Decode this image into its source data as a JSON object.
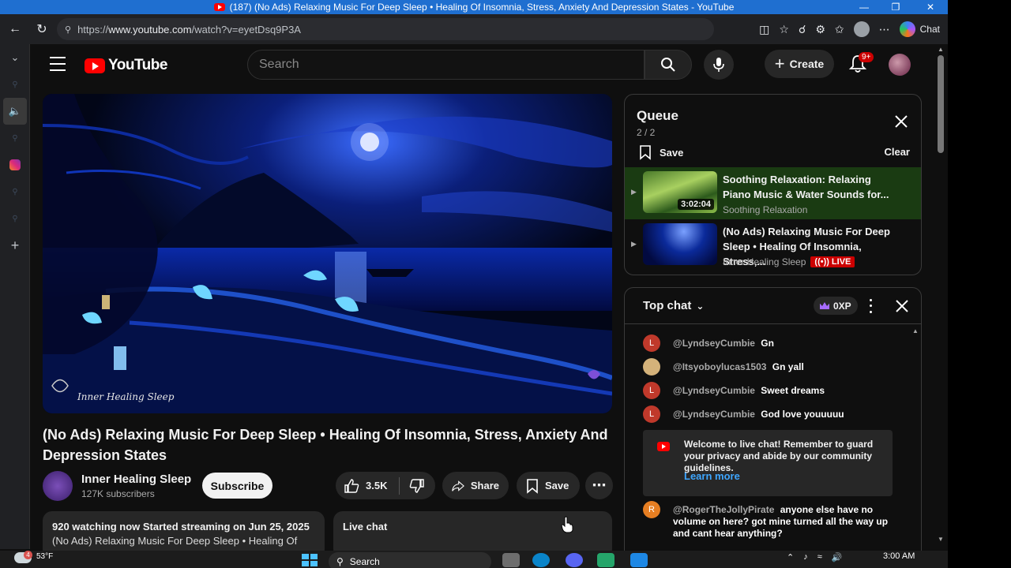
{
  "window": {
    "title": "(187) (No Ads) Relaxing Music For Deep Sleep • Healing Of Insomnia, Stress, Anxiety And Depression States - YouTube"
  },
  "address_bar": {
    "prefix": "https://",
    "host": "www.youtube.com",
    "path": "/watch?v=eyetDsq9P3A",
    "chat_label": "Chat"
  },
  "youtube": {
    "logo": "YouTube",
    "search_placeholder": "Search",
    "create_label": "Create",
    "notif_badge": "9+"
  },
  "video": {
    "title": "(No Ads) Relaxing Music For Deep Sleep • Healing Of Insomnia, Stress, Anxiety And Depression States",
    "watermark": "Inner Healing Sleep",
    "channel": "Inner Healing Sleep",
    "subscribers": "127K subscribers",
    "subscribe_label": "Subscribe",
    "likes": "3.5K",
    "share_label": "Share",
    "save_label": "Save",
    "desc_line1": "920 watching now  Started streaming on Jun 25, 2025",
    "desc_line2": "(No Ads) Relaxing Music For Deep Sleep • Healing Of",
    "live_chat_label": "Live chat"
  },
  "queue": {
    "title": "Queue",
    "count": "2 / 2",
    "save_label": "Save",
    "clear_label": "Clear",
    "items": [
      {
        "title": "Soothing Relaxation: Relaxing Piano Music & Water Sounds for...",
        "channel": "Soothing Relaxation",
        "duration": "3:02:04"
      },
      {
        "title": "(No Ads) Relaxing Music For Deep Sleep • Healing Of Insomnia, Stress,...",
        "channel": "Inner Healing Sleep",
        "badge": "LIVE"
      }
    ]
  },
  "chat": {
    "mode": "Top chat",
    "xp": "0XP",
    "messages": [
      {
        "initial": "L",
        "user": "@LyndseyCumbie",
        "text": "Gn",
        "color": "#c0392b"
      },
      {
        "initial": "",
        "user": "@Itsyoboylucas1503",
        "text": "Gn yall",
        "color": "#d4b27a"
      },
      {
        "initial": "L",
        "user": "@LyndseyCumbie",
        "text": "Sweet dreams",
        "color": "#c0392b"
      },
      {
        "initial": "L",
        "user": "@LyndseyCumbie",
        "text": "God love youuuuu",
        "color": "#c0392b"
      },
      {
        "initial": "R",
        "user": "@RogerTheJollyPirate",
        "text": "anyone else have no volume on here? got mine turned all the way up and cant hear anything?",
        "color": "#e67e22"
      }
    ],
    "welcome_text": "Welcome to live chat! Remember to guard your privacy and abide by our community guidelines.",
    "learn_more": "Learn more"
  },
  "taskbar": {
    "temperature": "53°F",
    "weather_badge": "4",
    "search_label": "Search",
    "time": "3:00 AM"
  },
  "colors": {
    "accent_blue": "#3ea6ff",
    "yt_red": "#ff0000",
    "queue_active_bg": "#1a3b12",
    "live_red": "#cc0000"
  }
}
